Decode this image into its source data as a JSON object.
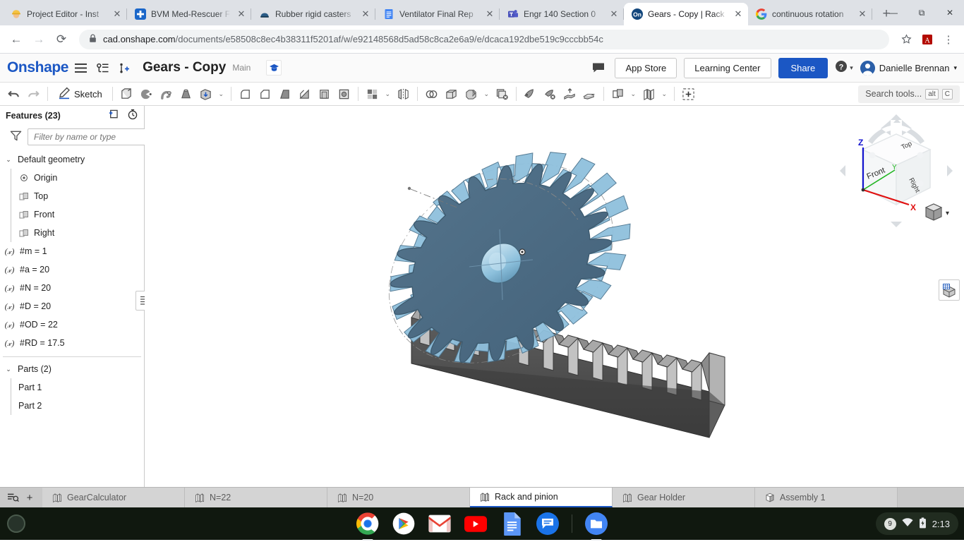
{
  "browser": {
    "tabs": [
      {
        "title": "Project Editor - Inst",
        "favicon": "construction-worker-icon",
        "active": false
      },
      {
        "title": "BVM Med-Rescuer F",
        "favicon": "medical-cross-icon",
        "active": false
      },
      {
        "title": "Rubber rigid casters",
        "favicon": "caster-icon",
        "active": false
      },
      {
        "title": "Ventilator Final Rep",
        "favicon": "google-docs-icon",
        "active": false
      },
      {
        "title": "Engr 140 Section 0",
        "favicon": "ms-teams-icon",
        "active": false
      },
      {
        "title": "Gears - Copy | Rack",
        "favicon": "onshape-icon",
        "active": true
      },
      {
        "title": "continuous rotation",
        "favicon": "google-icon",
        "active": false
      }
    ],
    "new_tab_label": "+",
    "window_controls": {
      "minimize": "—",
      "maximize": "⧉",
      "close": "✕"
    },
    "nav": {
      "back": "←",
      "forward": "→",
      "reload": "⟳"
    },
    "url_host": "cad.onshape.com",
    "url_path": "/documents/e58508c8ec4b38311f5201af/w/e92148568d5ad58c8ca2e6a9/e/dcaca192dbe519c9cccbb54c",
    "lock_icon": "lock-icon",
    "bookmark_icon": "star-icon",
    "pdf_icon": "adobe-pdf-icon",
    "menu_icon": "kebab-menu-icon"
  },
  "header": {
    "logo": "Onshape",
    "menu_icon": "hamburger-menu-icon",
    "versions_icon": "version-graph-icon",
    "insert_icon": "add-branch-icon",
    "doc_title": "Gears - Copy",
    "branch": "Main",
    "graduation_icon": "graduation-cap-icon",
    "comment_icon": "comment-bubble-icon",
    "app_store_label": "App Store",
    "learning_center_label": "Learning Center",
    "share_label": "Share",
    "help_icon": "help-circle-icon",
    "help_caret": "▾",
    "user_name": "Danielle Brennan",
    "user_caret": "▾",
    "avatar_icon": "user-avatar"
  },
  "toolbar": {
    "undo_icon": "undo-arrow-icon",
    "redo_icon": "redo-arrow-icon",
    "sketch_label": "Sketch",
    "sketch_icon": "pencil-icon",
    "tools": [
      "extrude-icon",
      "revolve-icon",
      "sweep-icon",
      "loft-icon",
      "thicken-icon",
      "fillet-icon",
      "chamfer-icon",
      "draft-icon",
      "rib-icon",
      "shell-icon",
      "hole-icon",
      "pattern-icon",
      "mirror-icon",
      "boolean-icon",
      "split-icon",
      "transform-icon",
      "delete-face-icon",
      "move-face-icon",
      "delete-part-icon",
      "offset-surface-icon",
      "enclose-icon",
      "plane-icon",
      "sketch-plane-icon",
      "curve-icon",
      "variable-icon"
    ],
    "search_placeholder": "Search tools...",
    "search_kbd_alt": "alt",
    "search_kbd_key": "C"
  },
  "features_panel": {
    "title": "Features (23)",
    "add_folder_icon": "add-folder-icon",
    "rollback_icon": "history-clock-icon",
    "filter_icon": "funnel-filter-icon",
    "filter_placeholder": "Filter by name or type",
    "groups": [
      {
        "label": "Default geometry",
        "caret": "⌄",
        "items": [
          {
            "label": "Origin",
            "icon": "origin-point-icon"
          },
          {
            "label": "Top",
            "icon": "plane-icon"
          },
          {
            "label": "Front",
            "icon": "plane-icon"
          },
          {
            "label": "Right",
            "icon": "plane-icon"
          }
        ]
      }
    ],
    "variables": [
      {
        "icon": "variable-x-icon",
        "label": "#m = 1"
      },
      {
        "icon": "variable-x-icon",
        "label": "#a = 20"
      },
      {
        "icon": "variable-x-icon",
        "label": "#N = 20"
      },
      {
        "icon": "variable-x-icon",
        "label": "#D = 20"
      },
      {
        "icon": "variable-x-icon",
        "label": "#OD = 22"
      },
      {
        "icon": "variable-x-icon",
        "label": "#RD = 17.5"
      }
    ],
    "parts": {
      "label": "Parts (2)",
      "caret": "⌄",
      "items": [
        {
          "label": "Part 1"
        },
        {
          "label": "Part 2"
        }
      ]
    },
    "resize_icon": "panel-collapse-icon"
  },
  "viewport": {
    "viewcube": {
      "axis_z": "Z",
      "axis_x": "X",
      "axis_y": "Y",
      "face_top": "Top",
      "face_front": "Front",
      "face_right": "Right",
      "view_menu_icon": "cube-view-icon",
      "view_menu_caret": "▾"
    },
    "display_states_icon": "display-state-icon",
    "model": {
      "gear_teeth": 20,
      "gear_face_color": "#4a6a80",
      "gear_tooth_color": "#8fc0dd",
      "rack_color": "#9a9a9a",
      "rack_side_color": "#4d4d4d"
    }
  },
  "bottom_tabs": {
    "tab_list_icon": "tab-list-icon",
    "add_tab_icon": "+",
    "tabs": [
      {
        "label": "GearCalculator",
        "icon": "part-studio-icon",
        "active": false
      },
      {
        "label": "N=22",
        "icon": "part-studio-icon",
        "active": false
      },
      {
        "label": "N=20",
        "icon": "part-studio-icon",
        "active": false
      },
      {
        "label": "Rack and pinion",
        "icon": "part-studio-icon",
        "active": true
      },
      {
        "label": "Gear Holder",
        "icon": "part-studio-icon",
        "active": false
      },
      {
        "label": "Assembly 1",
        "icon": "assembly-icon",
        "active": false
      }
    ]
  },
  "shelf": {
    "launcher_icon": "launcher-circle-icon",
    "apps": [
      {
        "name": "chrome-icon",
        "running": true
      },
      {
        "name": "play-store-icon",
        "running": false
      },
      {
        "name": "gmail-icon",
        "running": false
      },
      {
        "name": "youtube-icon",
        "running": false
      },
      {
        "name": "google-docs-icon",
        "running": false
      },
      {
        "name": "google-chat-icon",
        "running": false
      },
      {
        "name": "files-icon",
        "running": true
      }
    ],
    "status": {
      "notification_count": "9",
      "wifi_icon": "wifi-icon",
      "battery_icon": "battery-charging-icon",
      "time": "2:13"
    }
  }
}
